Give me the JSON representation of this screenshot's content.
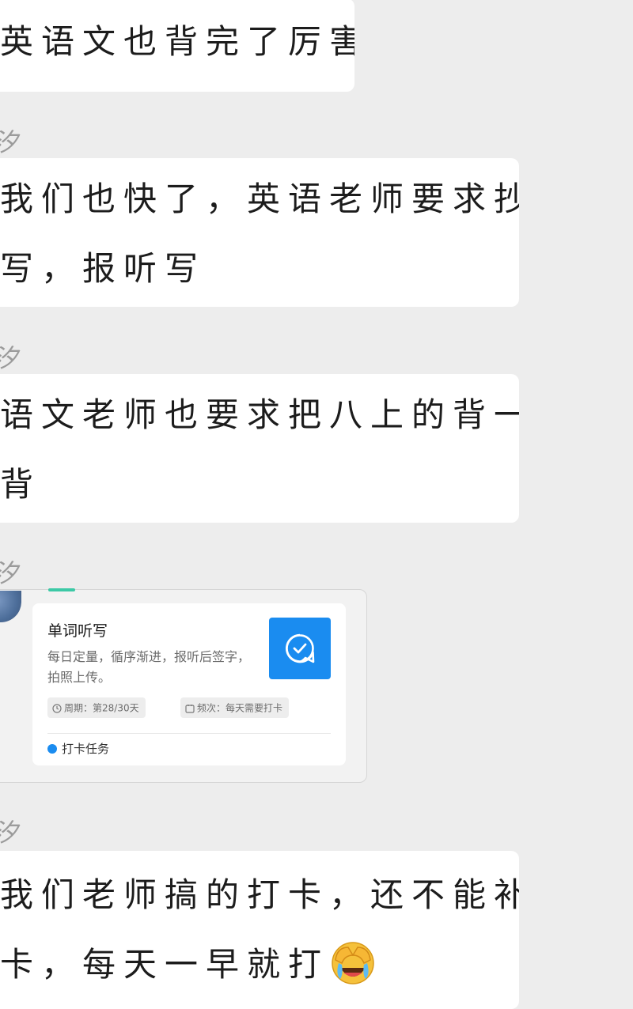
{
  "messages": [
    {
      "lines": [
        "英语文也背完了厉害"
      ]
    },
    {
      "sender": "汐",
      "lines": [
        "我们也快了，英语老师要求抄",
        "写，报听写"
      ]
    },
    {
      "sender": "汐",
      "lines": [
        "语文老师也要求把八上的背一",
        "背"
      ]
    },
    {
      "sender": "汐"
    },
    {
      "sender": "汐",
      "lines": [
        "我们老师搞的打卡，还不能补",
        "卡，每天一早就打"
      ],
      "emoji": "face-palm-crying-emoji"
    }
  ],
  "task_card": {
    "title": "单词听写",
    "description": "每日定量，循序渐进，报听后签字，拍照上传。",
    "period_chip": "周期：第28/30天",
    "frequency_chip": "频次：每天需要打卡",
    "footer_label": "打卡任务",
    "action_icon": "chat-check-icon",
    "accent_color": "#1a8cf0",
    "tab_color": "#3cc9a6"
  }
}
